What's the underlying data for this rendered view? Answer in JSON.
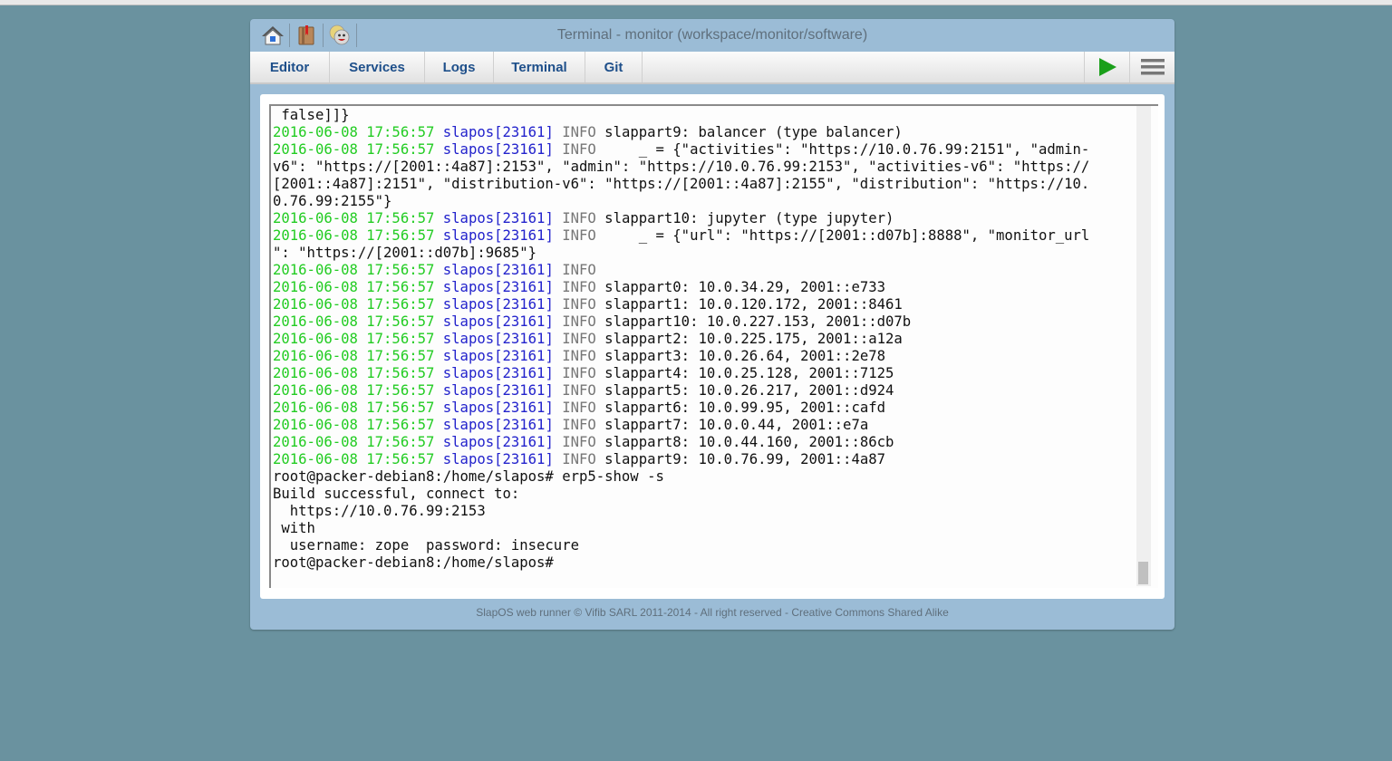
{
  "window": {
    "title": "Terminal - monitor (workspace/monitor/software)"
  },
  "toolbar_icons": [
    {
      "name": "home-icon"
    },
    {
      "name": "book-icon"
    },
    {
      "name": "smiley-faces-icon"
    }
  ],
  "nav": {
    "tabs": [
      {
        "label": "Editor"
      },
      {
        "label": "Services"
      },
      {
        "label": "Logs"
      },
      {
        "label": "Terminal"
      },
      {
        "label": "Git"
      }
    ],
    "run_button_icon": "play-icon",
    "menu_button_icon": "hamburger-menu-icon",
    "run_color": "#1a9f1a"
  },
  "terminal": {
    "colors": {
      "timestamp": "#22cc22",
      "process": "#2222cc",
      "level": "#777777"
    },
    "lines": [
      {
        "text": " false]]}"
      },
      {
        "ts": "2016-06-08 17:56:57",
        "proc": "slapos[23161]",
        "lvl": "INFO",
        "msg": " slappart9: balancer (type balancer)"
      },
      {
        "ts": "2016-06-08 17:56:57",
        "proc": "slapos[23161]",
        "lvl": "INFO",
        "msg": "     _ = {\"activities\": \"https://10.0.76.99:2151\", \"admin-"
      },
      {
        "text": "v6\": \"https://[2001::4a87]:2153\", \"admin\": \"https://10.0.76.99:2153\", \"activities-v6\": \"https://"
      },
      {
        "text": "[2001::4a87]:2151\", \"distribution-v6\": \"https://[2001::4a87]:2155\", \"distribution\": \"https://10."
      },
      {
        "text": "0.76.99:2155\"}"
      },
      {
        "ts": "2016-06-08 17:56:57",
        "proc": "slapos[23161]",
        "lvl": "INFO",
        "msg": " slappart10: jupyter (type jupyter)"
      },
      {
        "ts": "2016-06-08 17:56:57",
        "proc": "slapos[23161]",
        "lvl": "INFO",
        "msg": "     _ = {\"url\": \"https://[2001::d07b]:8888\", \"monitor_url"
      },
      {
        "text": "\": \"https://[2001::d07b]:9685\"}"
      },
      {
        "ts": "2016-06-08 17:56:57",
        "proc": "slapos[23161]",
        "lvl": "INFO",
        "msg": ""
      },
      {
        "ts": "2016-06-08 17:56:57",
        "proc": "slapos[23161]",
        "lvl": "INFO",
        "msg": " slappart0: 10.0.34.29, 2001::e733"
      },
      {
        "ts": "2016-06-08 17:56:57",
        "proc": "slapos[23161]",
        "lvl": "INFO",
        "msg": " slappart1: 10.0.120.172, 2001::8461"
      },
      {
        "ts": "2016-06-08 17:56:57",
        "proc": "slapos[23161]",
        "lvl": "INFO",
        "msg": " slappart10: 10.0.227.153, 2001::d07b"
      },
      {
        "ts": "2016-06-08 17:56:57",
        "proc": "slapos[23161]",
        "lvl": "INFO",
        "msg": " slappart2: 10.0.225.175, 2001::a12a"
      },
      {
        "ts": "2016-06-08 17:56:57",
        "proc": "slapos[23161]",
        "lvl": "INFO",
        "msg": " slappart3: 10.0.26.64, 2001::2e78"
      },
      {
        "ts": "2016-06-08 17:56:57",
        "proc": "slapos[23161]",
        "lvl": "INFO",
        "msg": " slappart4: 10.0.25.128, 2001::7125"
      },
      {
        "ts": "2016-06-08 17:56:57",
        "proc": "slapos[23161]",
        "lvl": "INFO",
        "msg": " slappart5: 10.0.26.217, 2001::d924"
      },
      {
        "ts": "2016-06-08 17:56:57",
        "proc": "slapos[23161]",
        "lvl": "INFO",
        "msg": " slappart6: 10.0.99.95, 2001::cafd"
      },
      {
        "ts": "2016-06-08 17:56:57",
        "proc": "slapos[23161]",
        "lvl": "INFO",
        "msg": " slappart7: 10.0.0.44, 2001::e7a"
      },
      {
        "ts": "2016-06-08 17:56:57",
        "proc": "slapos[23161]",
        "lvl": "INFO",
        "msg": " slappart8: 10.0.44.160, 2001::86cb"
      },
      {
        "ts": "2016-06-08 17:56:57",
        "proc": "slapos[23161]",
        "lvl": "INFO",
        "msg": " slappart9: 10.0.76.99, 2001::4a87"
      },
      {
        "text": "root@packer-debian8:/home/slapos# erp5-show -s"
      },
      {
        "text": "Build successful, connect to:"
      },
      {
        "text": "  https://10.0.76.99:2153"
      },
      {
        "text": " with"
      },
      {
        "text": "  username: zope  password: insecure"
      },
      {
        "text": "root@packer-debian8:/home/slapos# "
      }
    ]
  },
  "footer": {
    "text": "SlapOS web runner © Vifib SARL 2011-2014 - All right reserved - Creative Commons Shared Alike"
  }
}
